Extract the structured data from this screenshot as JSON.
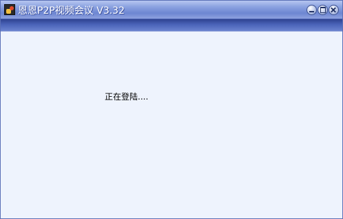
{
  "window": {
    "title": "恩恩P2P视频会议 V3.32",
    "icon": "app-logo-icon",
    "controls": [
      "minimize-icon",
      "restore-icon",
      "close-icon"
    ]
  },
  "content": {
    "status_text": "正在登陆...."
  },
  "colors": {
    "titlebar": "#7a91d6",
    "band": "#3f56a8",
    "content_bg": "#eef3fd"
  }
}
